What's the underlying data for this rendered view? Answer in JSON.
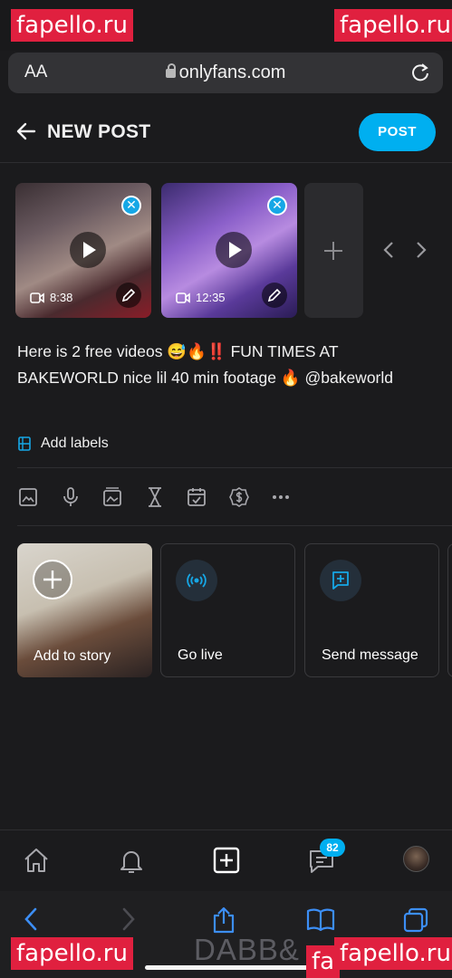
{
  "watermarks": [
    "fapello.ru",
    "fapello.ru",
    "fapello.ru",
    "fa",
    "fapello.ru"
  ],
  "browser": {
    "text_size_label": "AA",
    "host": "onlyfans.com",
    "icons": [
      "lock-icon",
      "reload-icon"
    ]
  },
  "header": {
    "title": "NEW POST",
    "post_button": "POST",
    "accent_color": "#00aff0"
  },
  "media": [
    {
      "duration": "8:38",
      "icons": [
        "play-icon",
        "remove-icon",
        "video-icon",
        "edit-icon"
      ]
    },
    {
      "duration": "12:35",
      "icons": [
        "play-icon",
        "remove-icon",
        "video-icon",
        "edit-icon"
      ]
    }
  ],
  "caption": {
    "text_1": "Here is 2 free videos 😅🔥",
    "text_2": "‼️",
    "text_3": "  FUN TIMES AT BAKEWORLD nice lil 40 min footage 🔥 @bakeworld"
  },
  "labels": {
    "add_label": "Add labels"
  },
  "toolbar": [
    "image-icon",
    "microphone-icon",
    "media-vault-icon",
    "hourglass-icon",
    "calendar-check-icon",
    "price-tag-icon",
    "more-icon"
  ],
  "cards": {
    "story": "Add to story",
    "live": "Go live",
    "message": "Send message"
  },
  "nav": {
    "messages_badge": "82",
    "icons": [
      "home-icon",
      "bell-icon",
      "add-post-icon",
      "messages-icon",
      "avatar"
    ]
  },
  "safari": {
    "footer_text": "DABB&",
    "icons": [
      "back-icon",
      "forward-icon",
      "share-icon",
      "bookmarks-icon",
      "tabs-icon"
    ]
  }
}
